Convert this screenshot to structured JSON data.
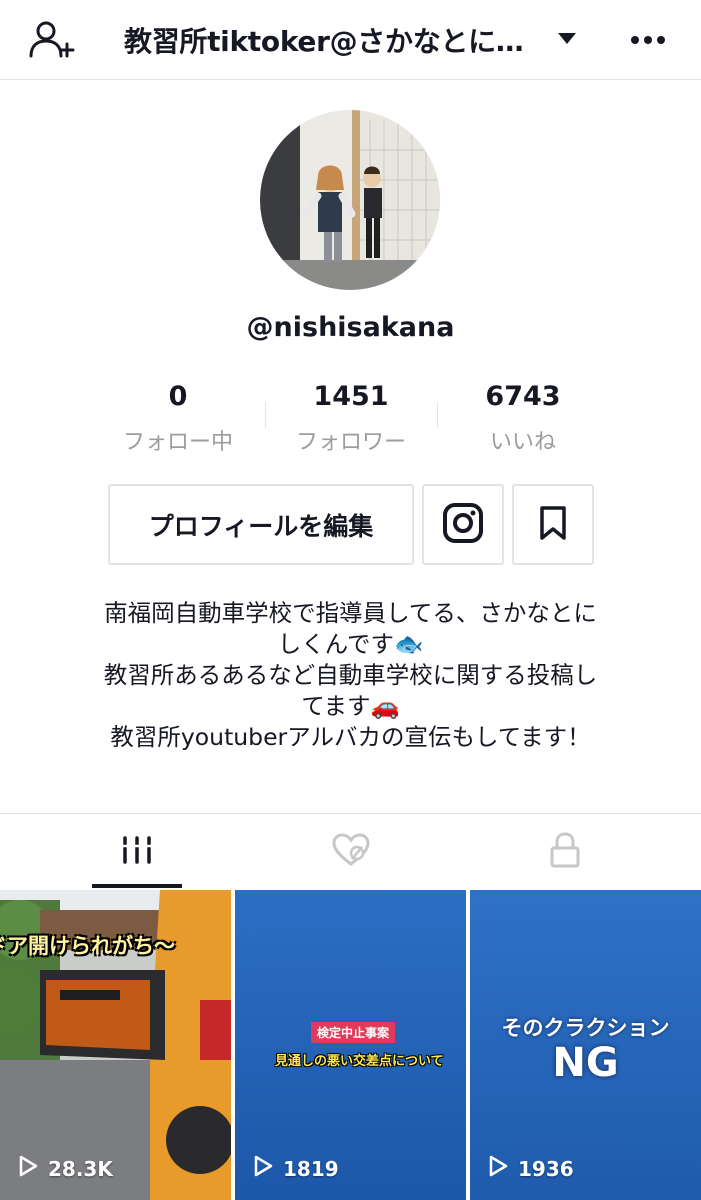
{
  "header": {
    "title": "教習所tiktoker@さかなとに…",
    "add_user_icon": "add-user-icon",
    "caret_icon": "chevron-down-icon",
    "more_icon": "more-icon"
  },
  "profile": {
    "handle": "@nishisakana",
    "stats": [
      {
        "value": "0",
        "label": "フォロー中"
      },
      {
        "value": "1451",
        "label": "フォロワー"
      },
      {
        "value": "6743",
        "label": "いいね"
      }
    ],
    "edit_button": "プロフィールを編集",
    "instagram_icon": "instagram-icon",
    "bookmark_icon": "bookmark-icon",
    "bio": [
      "南福岡自動車学校で指導員してる、さかなとに",
      "しくんです🐟",
      "教習所あるあるなど自動車学校に関する投稿し",
      "てます🚗",
      "教習所youtuberアルバカの宣伝もしてます！"
    ]
  },
  "tabs": [
    {
      "name": "videos",
      "icon": "grid-icon",
      "active": true
    },
    {
      "name": "liked",
      "icon": "liked-hidden-icon",
      "active": false
    },
    {
      "name": "private",
      "icon": "lock-icon",
      "active": false
    }
  ],
  "videos": [
    {
      "caption": "ドア開けられがち〜",
      "views": "28.3K"
    },
    {
      "caption_top": "検定中止事案",
      "caption_bottom": "見通しの悪い交差点について",
      "views": "1819"
    },
    {
      "caption_top": "そのクラクション",
      "caption_bottom": "NG",
      "views": "1936"
    }
  ],
  "colors": {
    "text": "#161823",
    "secondary_text": "#9c9ca0",
    "border": "#e3e3e4",
    "video_blue": "#2f6fc2"
  }
}
